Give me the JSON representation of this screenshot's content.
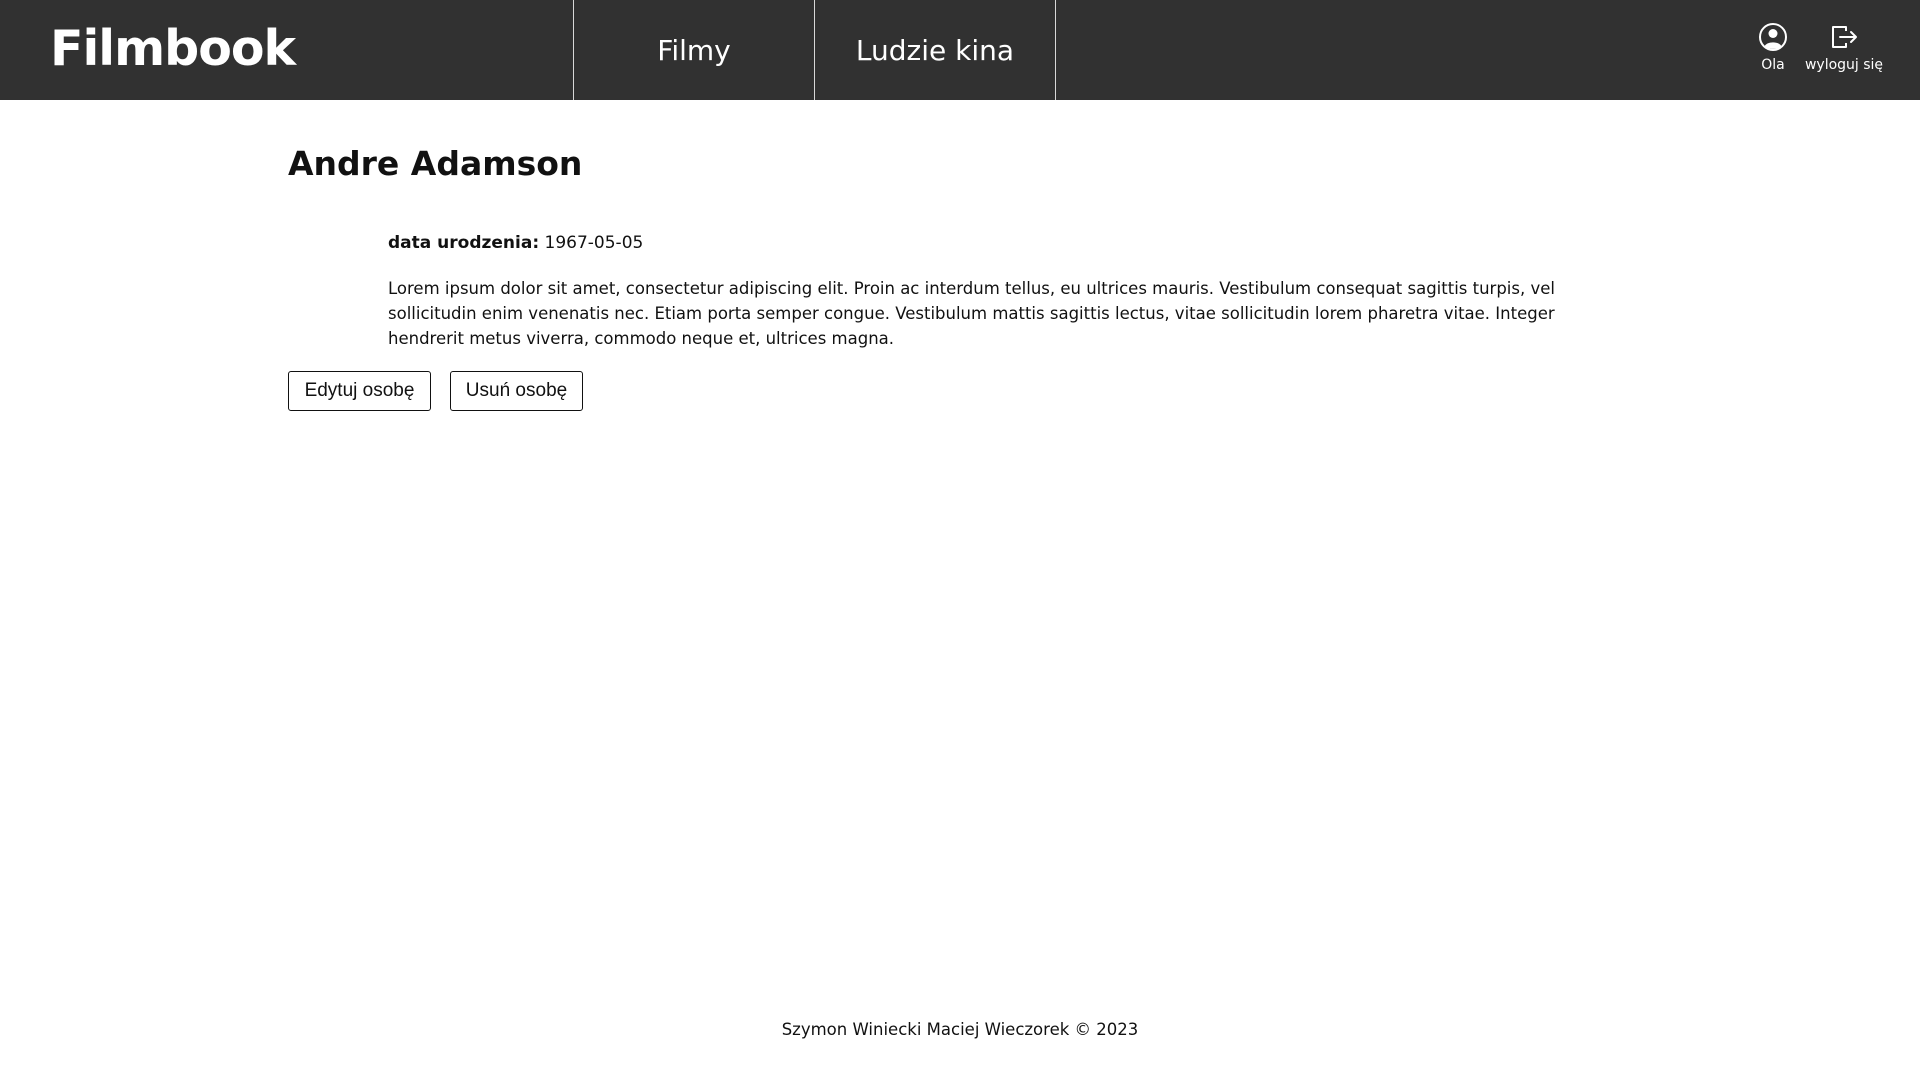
{
  "app": {
    "logo_text": "Filmbook"
  },
  "nav": {
    "items": [
      {
        "label": "Filmy"
      },
      {
        "label": "Ludzie kina"
      }
    ]
  },
  "user": {
    "name": "Ola",
    "logout_label": "wyloguj się",
    "icons": [
      "user-circle-icon",
      "logout-icon"
    ]
  },
  "person": {
    "name": "Andre Adamson",
    "birth_label": "data urodzenia:",
    "birth_date": "1967-05-05",
    "bio": "Lorem ipsum dolor sit amet, consectetur adipiscing elit. Proin ac interdum tellus, eu ultrices mauris. Vestibulum consequat sagittis turpis, vel sollicitudin enim venenatis nec. Etiam porta semper congue. Vestibulum mattis sagittis lectus, vitae sollicitudin lorem pharetra vitae. Integer hendrerit metus viverra, commodo neque et, ultrices magna."
  },
  "actions": {
    "edit_label": "Edytuj osobę",
    "delete_label": "Usuń osobę"
  },
  "footer": {
    "text": "Szymon Winiecki Maciej Wieczorek © 2023"
  },
  "colors": {
    "navbar_bg": "#313131",
    "page_bg": "#ffffff",
    "text": "#111111"
  }
}
